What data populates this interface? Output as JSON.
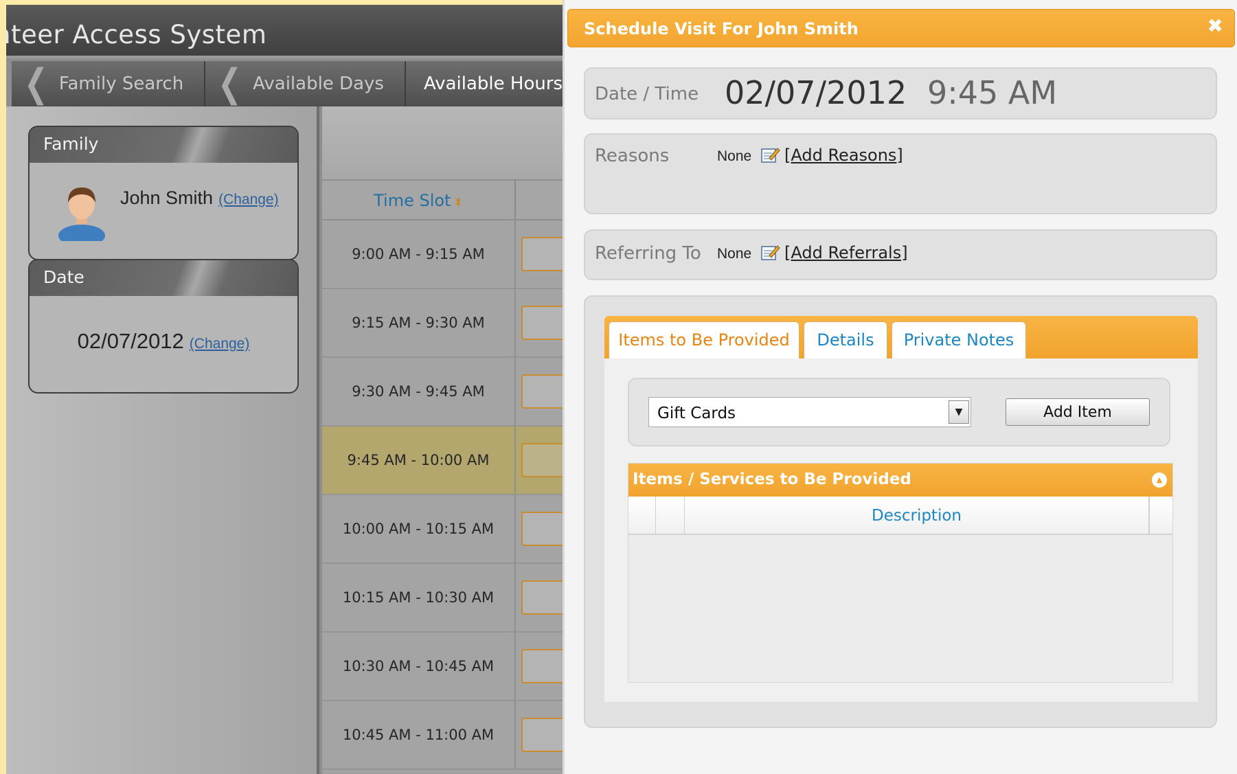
{
  "app": {
    "title": "nteer Access System",
    "breadcrumbs": [
      {
        "label": "Family Search"
      },
      {
        "label": "Available Days"
      },
      {
        "label": "Available Hours"
      }
    ]
  },
  "family_panel": {
    "heading": "Family",
    "name": "John Smith",
    "change_label": "(Change)"
  },
  "date_panel": {
    "heading": "Date",
    "value": "02/07/2012",
    "change_label": "(Change)"
  },
  "time_slots": {
    "column_header": "Time Slot",
    "sort_icon": "sort-arrows-icon",
    "rows": [
      {
        "label": "9:00 AM - 9:15 AM",
        "selected": false
      },
      {
        "label": "9:15 AM - 9:30 AM",
        "selected": false
      },
      {
        "label": "9:30 AM - 9:45 AM",
        "selected": false
      },
      {
        "label": "9:45 AM - 10:00 AM",
        "selected": true
      },
      {
        "label": "10:00 AM - 10:15 AM",
        "selected": false
      },
      {
        "label": "10:15 AM - 10:30 AM",
        "selected": false
      },
      {
        "label": "10:30 AM - 10:45 AM",
        "selected": false
      },
      {
        "label": "10:45 AM - 11:00 AM",
        "selected": false
      }
    ]
  },
  "dialog": {
    "title": "Schedule Visit For John Smith",
    "close_glyph": "✖",
    "datetime": {
      "label": "Date / Time",
      "date": "02/07/2012",
      "time": "9:45 AM"
    },
    "reasons": {
      "label": "Reasons",
      "value": "None",
      "link": "[Add Reasons]"
    },
    "referring": {
      "label": "Referring To",
      "value": "None",
      "link": "[Add Referrals]"
    },
    "tabs": [
      {
        "label": "Items to Be Provided",
        "active": true
      },
      {
        "label": "Details",
        "active": false
      },
      {
        "label": "Private Notes",
        "active": false
      }
    ],
    "item_select": {
      "selected": "Gift Cards"
    },
    "add_item_label": "Add Item",
    "grid": {
      "caption": "Items / Services to Be Provided",
      "description_header": "Description"
    }
  },
  "colors": {
    "accent_orange": "#f3a530",
    "link_blue": "#1d86c4",
    "selected_row": "#b3a76d"
  }
}
